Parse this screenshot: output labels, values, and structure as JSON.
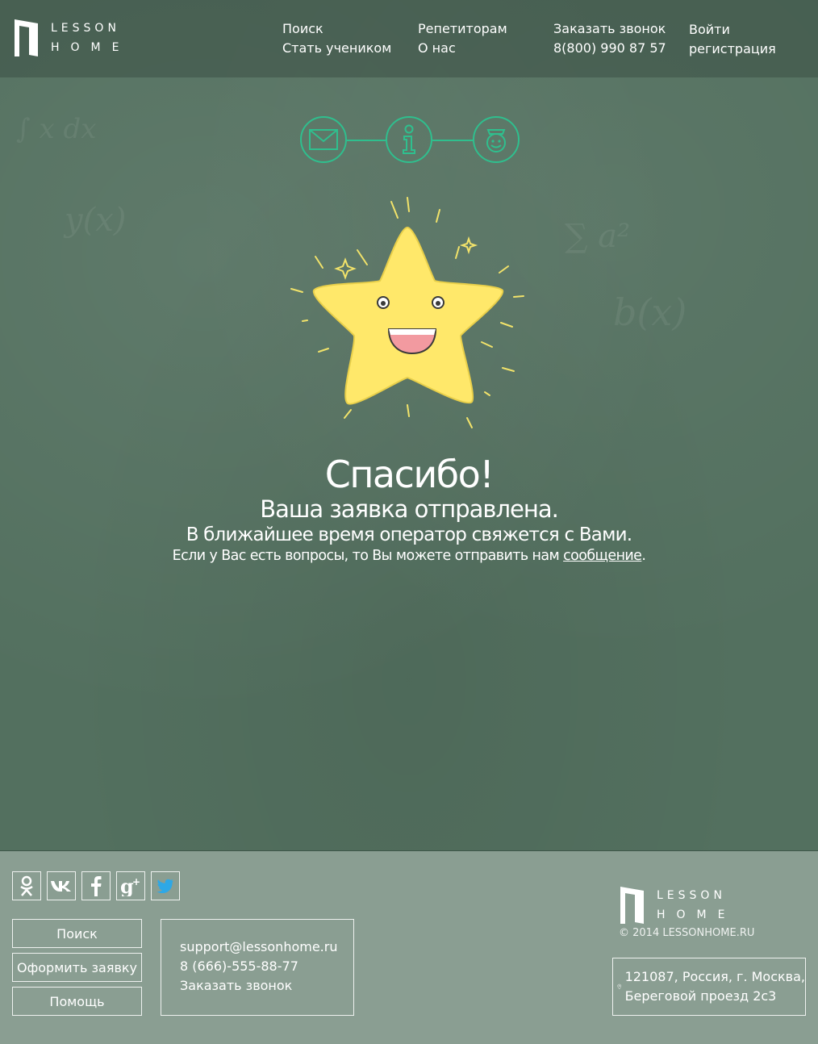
{
  "brand": {
    "line1": "LESSON",
    "line2": "HOME"
  },
  "nav": {
    "col1": [
      "Поиск",
      "Стать учеником"
    ],
    "col2": [
      "Репетиторам",
      "О нас"
    ],
    "col3": [
      "Заказать звонок",
      "8(800) 990 87 57"
    ],
    "col4": [
      "Войти",
      "регистрация"
    ]
  },
  "steps": [
    {
      "icon": "envelope-icon"
    },
    {
      "icon": "info-icon"
    },
    {
      "icon": "graduate-smile-icon"
    }
  ],
  "message": {
    "title": "Спасибо!",
    "subtitle": "Ваша заявка отправлена.",
    "text": "В ближайшее время оператор свяжется с Вами.",
    "note_prefix": "Если у Вас есть вопросы, то Вы можете отправить нам ",
    "note_link": "сообщение",
    "note_suffix": "."
  },
  "footer": {
    "socials": [
      {
        "icon": "odnoklassniki-icon",
        "glyph": "ок"
      },
      {
        "icon": "vk-icon",
        "glyph": "vk"
      },
      {
        "icon": "facebook-icon",
        "glyph": "f"
      },
      {
        "icon": "google-plus-icon",
        "glyph": "g+"
      },
      {
        "icon": "twitter-icon",
        "glyph": "t"
      }
    ],
    "buttons": [
      "Поиск",
      "Оформить заявку",
      "Помощь"
    ],
    "contacts": {
      "email": "support@lessonhome.ru",
      "phone": "8 (666)-555-88-77",
      "callback": "Заказать звонок"
    },
    "copyright": "© 2014 LESSONHOME.RU",
    "address": {
      "line1": "121087, Россия, г. Москва,",
      "line2": "Береговой проезд 2с3"
    }
  },
  "colors": {
    "board": "#53705f",
    "accent": "#2fbf8e",
    "star": "#ffe86a",
    "footer": "#8a9e92"
  }
}
